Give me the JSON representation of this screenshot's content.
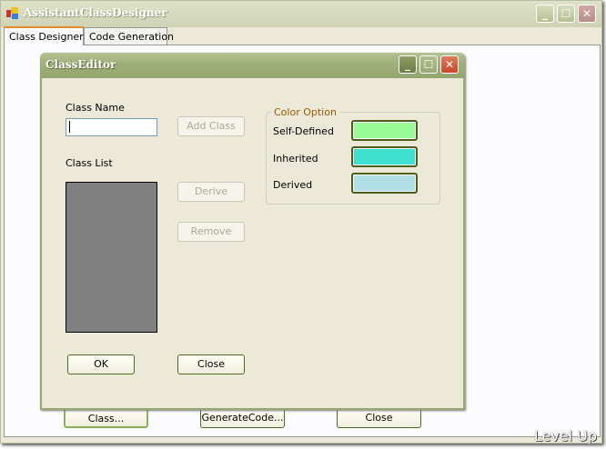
{
  "main_window": {
    "title": "AssistantClassDesigner",
    "tabs": [
      {
        "label": "Class Designer",
        "active": true
      },
      {
        "label": "Code Generation",
        "active": false
      }
    ],
    "buttons": {
      "class": "Class...",
      "generate": "GenerateCode...",
      "close": "Close"
    }
  },
  "dialog": {
    "title": "ClassEditor",
    "class_name_label": "Class Name",
    "class_name_value": "",
    "class_list_label": "Class List",
    "add_class": "Add Class",
    "derive": "Derive",
    "remove": "Remove",
    "ok": "OK",
    "close": "Close",
    "color_option": {
      "title": "Color Option",
      "items": [
        {
          "label": "Self-Defined",
          "color": "#98fb98"
        },
        {
          "label": "Inherited",
          "color": "#40e0d0"
        },
        {
          "label": "Derived",
          "color": "#b0e0e6"
        }
      ]
    }
  },
  "watermark": "Level Up"
}
